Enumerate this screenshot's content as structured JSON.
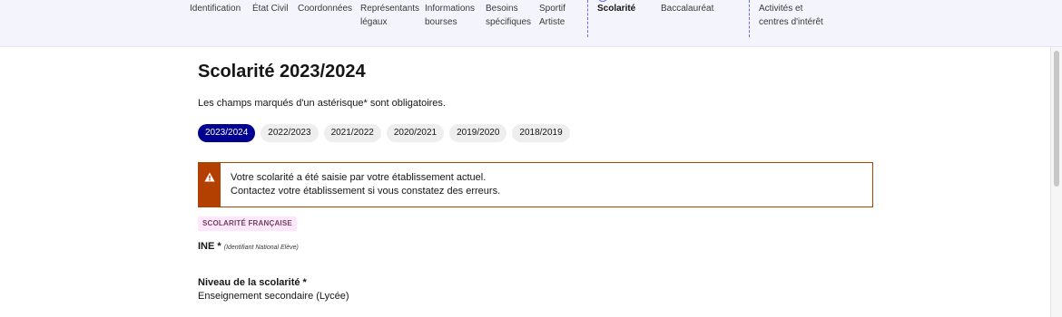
{
  "nav": {
    "items": [
      {
        "label": "Identification"
      },
      {
        "label": "État Civil"
      },
      {
        "label": "Coordonnées"
      },
      {
        "label": "Représentants\nlégaux"
      },
      {
        "label": "Informations\nbourses"
      },
      {
        "label": "Besoins\nspécifiques"
      },
      {
        "label": "Sportif\nArtiste"
      },
      {
        "label": "Scolarité",
        "active": true
      },
      {
        "label": "Baccalauréat"
      },
      {
        "label": "Activités et\ncentres d'intérêt"
      }
    ]
  },
  "page": {
    "title": "Scolarité 2023/2024",
    "intro": "Les champs marqués d'un astérisque* sont obligatoires."
  },
  "years": {
    "items": [
      "2023/2024",
      "2022/2023",
      "2021/2022",
      "2020/2021",
      "2019/2020",
      "2018/2019"
    ],
    "selected": "2023/2024"
  },
  "alert": {
    "line1": "Votre scolarité a été saisie par votre établissement actuel.",
    "line2": "Contactez votre établissement si vous constatez des erreurs.",
    "icon": "warning-icon"
  },
  "section": {
    "badge": "SCOLARITÉ FRANÇAISE"
  },
  "ine": {
    "label": "INE *",
    "hint": "(Identifiant National Elève)"
  },
  "level": {
    "label": "Niveau de la scolarité *",
    "value": "Enseignement secondaire (Lycée)"
  },
  "colors": {
    "primary": "#000091",
    "warning": "#b34000",
    "badge_bg": "#fee7fc",
    "badge_text": "#6e445a",
    "nav_bg": "#f4f4fc",
    "separator": "#6a6af4"
  }
}
